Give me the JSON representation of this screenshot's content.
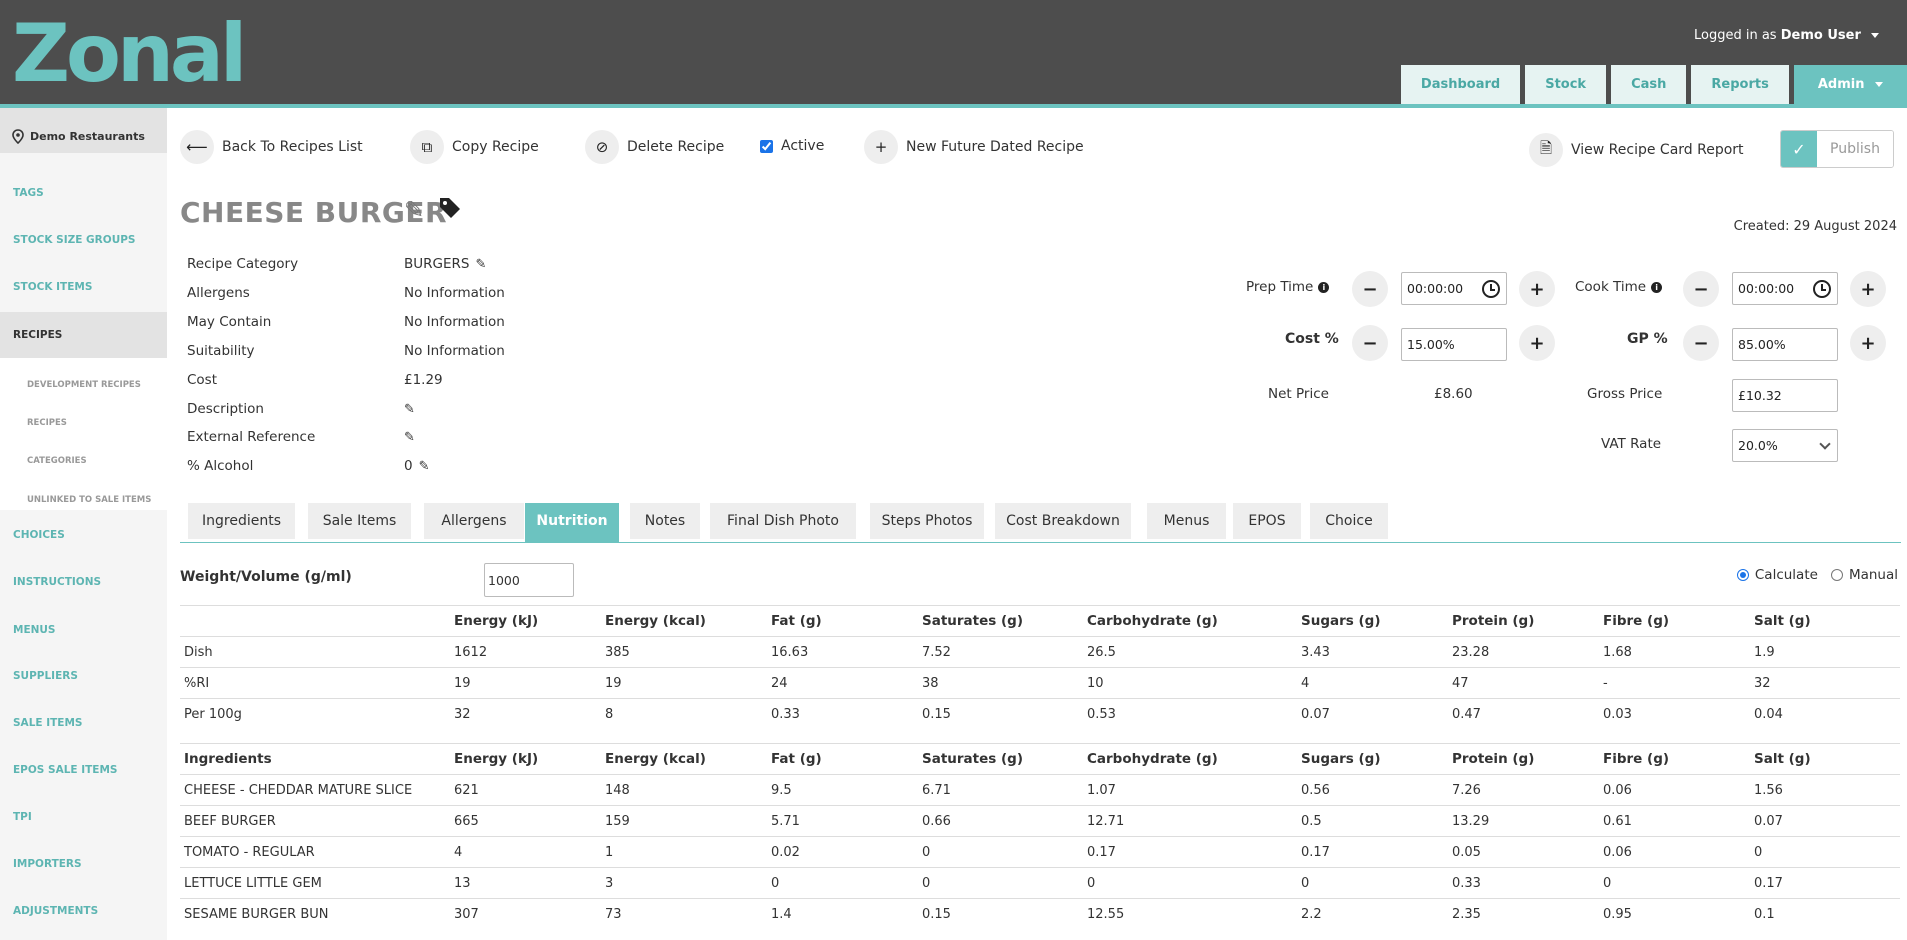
{
  "header": {
    "logo": "Zonal",
    "logged_in_prefix": "Logged in as",
    "user": "Demo User",
    "nav": [
      "Dashboard",
      "Stock",
      "Cash",
      "Reports"
    ],
    "nav_admin": "Admin"
  },
  "sidebar": {
    "site": "Demo Restaurants",
    "items": [
      "TAGS",
      "STOCK SIZE GROUPS",
      "STOCK ITEMS",
      "RECIPES",
      "CHOICES",
      "INSTRUCTIONS",
      "MENUS",
      "SUPPLIERS",
      "SALE ITEMS",
      "EPOS SALE ITEMS",
      "TPI",
      "IMPORTERS",
      "ADJUSTMENTS"
    ],
    "subitems": [
      "DEVELOPMENT RECIPES",
      "RECIPES",
      "CATEGORIES",
      "UNLINKED TO SALE ITEMS"
    ]
  },
  "toolbar": {
    "back": "Back To Recipes List",
    "copy": "Copy Recipe",
    "delete": "Delete Recipe",
    "active": "Active",
    "new_future": "New Future Dated Recipe",
    "view_report": "View Recipe Card Report",
    "publish": "Publish"
  },
  "recipe": {
    "title": "CHEESE BURGER",
    "created": "Created: 29 August 2024",
    "props": [
      {
        "label": "Recipe Category",
        "value": "BURGERS"
      },
      {
        "label": "Allergens",
        "value": "No Information"
      },
      {
        "label": "May Contain",
        "value": "No Information"
      },
      {
        "label": "Suitability",
        "value": "No Information"
      },
      {
        "label": "Cost",
        "value": "£1.29"
      },
      {
        "label": "Description",
        "value": ""
      },
      {
        "label": "External Reference",
        "value": ""
      },
      {
        "label": "% Alcohol",
        "value": "0"
      }
    ]
  },
  "pricing": {
    "prep_label": "Prep Time",
    "prep_value": "00:00:00",
    "cook_label": "Cook Time",
    "cook_value": "00:00:00",
    "cost_pct_label": "Cost %",
    "cost_pct_value": "15.00%",
    "gp_label": "GP %",
    "gp_value": "85.00%",
    "net_label": "Net Price",
    "net_value": "£8.60",
    "gross_label": "Gross Price",
    "gross_value": "£10.32",
    "vat_label": "VAT Rate",
    "vat_value": "20.0%"
  },
  "tabs": [
    "Ingredients",
    "Sale Items",
    "Allergens",
    "Nutrition",
    "Notes",
    "Final Dish Photo",
    "Steps Photos",
    "Cost Breakdown",
    "Menus",
    "EPOS",
    "Choice"
  ],
  "active_tab": "Nutrition",
  "nutrition": {
    "weight_label": "Weight/Volume (g/ml)",
    "weight_value": "1000",
    "calculate": "Calculate",
    "manual": "Manual",
    "columns": [
      "Energy (kJ)",
      "Energy (kcal)",
      "Fat (g)",
      "Saturates (g)",
      "Carbohydrate (g)",
      "Sugars (g)",
      "Protein (g)",
      "Fibre (g)",
      "Salt (g)"
    ],
    "summary_rows": [
      {
        "name": "Dish",
        "values": [
          "1612",
          "385",
          "16.63",
          "7.52",
          "26.5",
          "3.43",
          "23.28",
          "1.68",
          "1.9"
        ]
      },
      {
        "name": "%RI",
        "values": [
          "19",
          "19",
          "24",
          "38",
          "10",
          "4",
          "47",
          "-",
          "32"
        ]
      },
      {
        "name": "Per 100g",
        "values": [
          "32",
          "8",
          "0.33",
          "0.15",
          "0.53",
          "0.07",
          "0.47",
          "0.03",
          "0.04"
        ]
      }
    ],
    "ingredients_header": "Ingredients",
    "ingredient_rows": [
      {
        "name": "CHEESE - CHEDDAR MATURE SLICE",
        "values": [
          "621",
          "148",
          "9.5",
          "6.71",
          "1.07",
          "0.56",
          "7.26",
          "0.06",
          "1.56"
        ]
      },
      {
        "name": "BEEF BURGER",
        "values": [
          "665",
          "159",
          "5.71",
          "0.66",
          "12.71",
          "0.5",
          "13.29",
          "0.61",
          "0.07"
        ]
      },
      {
        "name": "TOMATO - REGULAR",
        "values": [
          "4",
          "1",
          "0.02",
          "0",
          "0.17",
          "0.17",
          "0.05",
          "0.06",
          "0"
        ]
      },
      {
        "name": "LETTUCE LITTLE GEM",
        "values": [
          "13",
          "3",
          "0",
          "0",
          "0",
          "0",
          "0.33",
          "0",
          "0.17"
        ]
      },
      {
        "name": "SESAME BURGER BUN",
        "values": [
          "307",
          "73",
          "1.4",
          "0.15",
          "12.55",
          "2.2",
          "2.35",
          "0.95",
          "0.1"
        ]
      }
    ]
  }
}
